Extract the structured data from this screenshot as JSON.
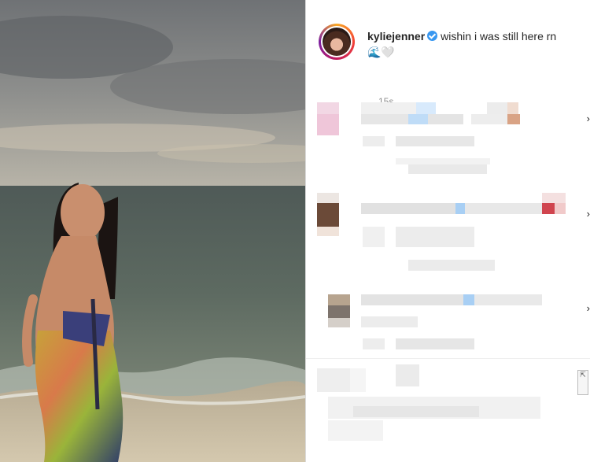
{
  "post": {
    "username": "kyliejenner",
    "caption": "wishin i was still here rn",
    "caption_emojis": "🌊🤍",
    "timestamp": "15s"
  },
  "icons": {
    "verified": "verified-badge-icon",
    "chevron": "chevron-right-icon"
  },
  "colors": {
    "verified_blue": "#3897f0",
    "text": "#262626",
    "muted": "#8e8e8e",
    "divider": "#dbdbdb"
  },
  "comments": {
    "chevron": "›"
  }
}
